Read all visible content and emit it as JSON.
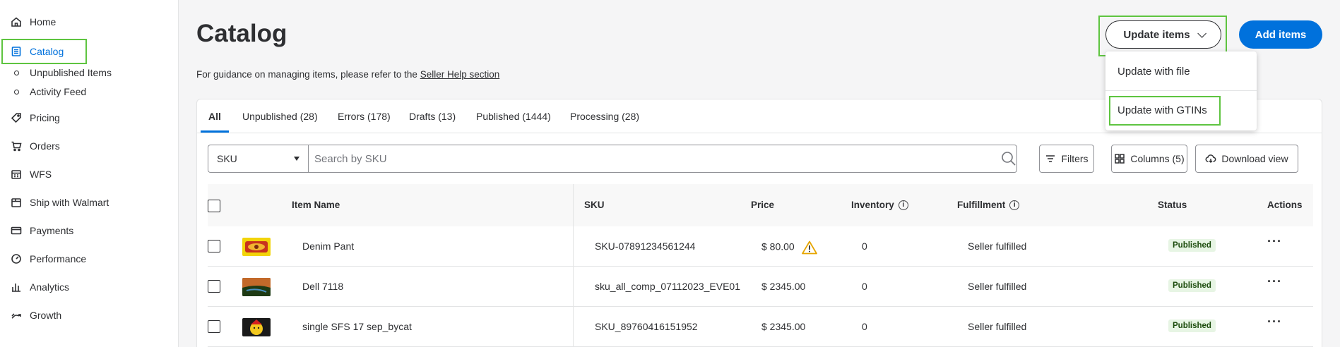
{
  "sidebar": {
    "items": [
      {
        "label": "Home",
        "icon": "home-icon"
      },
      {
        "label": "Catalog",
        "icon": "catalog-icon"
      },
      {
        "label": "Pricing",
        "icon": "tag-icon"
      },
      {
        "label": "Orders",
        "icon": "cart-icon"
      },
      {
        "label": "WFS",
        "icon": "warehouse-icon"
      },
      {
        "label": "Ship with Walmart",
        "icon": "shipping-icon"
      },
      {
        "label": "Payments",
        "icon": "card-icon"
      },
      {
        "label": "Performance",
        "icon": "gauge-icon"
      },
      {
        "label": "Analytics",
        "icon": "bar-chart-icon"
      },
      {
        "label": "Growth",
        "icon": "growth-icon"
      }
    ],
    "sub_items": [
      {
        "label": "Unpublished Items"
      },
      {
        "label": "Activity Feed"
      }
    ]
  },
  "header": {
    "title": "Catalog",
    "guidance_text": "For guidance on managing items, please refer to the ",
    "guidance_link": "Seller Help section",
    "update_button": "Update items",
    "add_button": "Add items"
  },
  "dropdown": {
    "items": [
      {
        "label": "Update with file"
      },
      {
        "label": "Update with GTINs"
      }
    ]
  },
  "tabs": [
    {
      "label": "All"
    },
    {
      "label": "Unpublished (28)"
    },
    {
      "label": "Errors (178)"
    },
    {
      "label": "Drafts (13)"
    },
    {
      "label": "Published (1444)"
    },
    {
      "label": "Processing (28)"
    }
  ],
  "search": {
    "field": "SKU",
    "placeholder": "Search by SKU"
  },
  "toolbar": {
    "filters": "Filters",
    "columns": "Columns (5)",
    "download": "Download view"
  },
  "table": {
    "headers": {
      "item_name": "Item Name",
      "sku": "SKU",
      "price": "Price",
      "inventory": "Inventory",
      "fulfillment": "Fulfillment",
      "status": "Status",
      "actions": "Actions"
    },
    "rows": [
      {
        "name": "Denim Pant",
        "sku": "SKU-07891234561244",
        "price": "$ 80.00",
        "inventory": "0",
        "fulfillment": "Seller fulfilled",
        "status": "Published"
      },
      {
        "name": "Dell 7118",
        "sku": "sku_all_comp_07112023_EVE01",
        "price": "$ 2345.00",
        "inventory": "0",
        "fulfillment": "Seller fulfilled",
        "status": "Published"
      },
      {
        "name": "single SFS 17 sep_bycat",
        "sku": "SKU_89760416151952",
        "price": "$ 2345.00",
        "inventory": "0",
        "fulfillment": "Seller fulfilled",
        "status": "Published"
      }
    ]
  },
  "colors": {
    "accent": "#0071dc",
    "highlight": "#5ec440",
    "badge_bg": "#e7f5e4",
    "warning": "#e6a500"
  }
}
